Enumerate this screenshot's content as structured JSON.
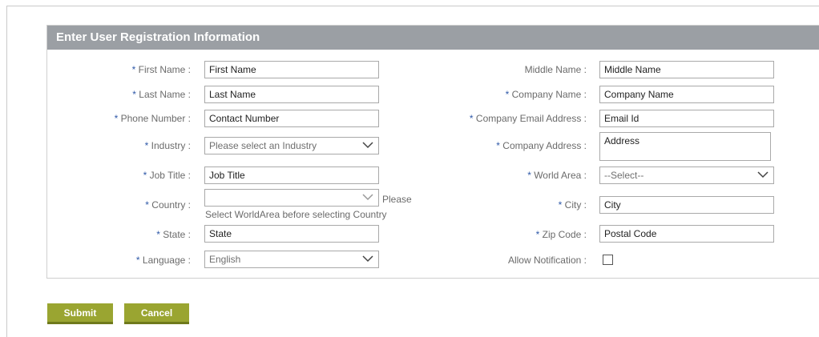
{
  "form": {
    "title": "Enter User Registration Information",
    "required_mark": "*",
    "left": {
      "first_name": {
        "label": " First Name :",
        "value": "First Name"
      },
      "last_name": {
        "label": " Last Name :",
        "value": "Last Name"
      },
      "phone": {
        "label": " Phone Number :",
        "value": "Contact Number"
      },
      "industry": {
        "label": " Industry :",
        "value": "Please select an Industry"
      },
      "job_title": {
        "label": " Job Title :",
        "value": "Job Title"
      },
      "country": {
        "label": " Country :",
        "value": "",
        "note_inline": "Please",
        "note_below": "Select WorldArea before selecting Country"
      },
      "state": {
        "label": " State :",
        "value": "State"
      },
      "language": {
        "label": " Language :",
        "value": "English"
      }
    },
    "right": {
      "middle_name": {
        "label": "Middle Name :",
        "value": "Middle Name"
      },
      "company_name": {
        "label": " Company Name :",
        "value": "Company Name"
      },
      "company_email": {
        "label": " Company Email Address :",
        "value": "Email Id"
      },
      "company_address": {
        "label": " Company Address :",
        "value": "Address"
      },
      "world_area": {
        "label": " World Area :",
        "value": "--Select--"
      },
      "city": {
        "label": " City :",
        "value": "City"
      },
      "zip": {
        "label": " Zip Code :",
        "value": "Postal Code"
      },
      "notification": {
        "label": "Allow Notification :",
        "checked": false
      }
    }
  },
  "buttons": {
    "submit": "Submit",
    "cancel": "Cancel"
  },
  "colors": {
    "header": "#9b9fa4",
    "required": "#2f59a8",
    "button": "#9aa531"
  }
}
